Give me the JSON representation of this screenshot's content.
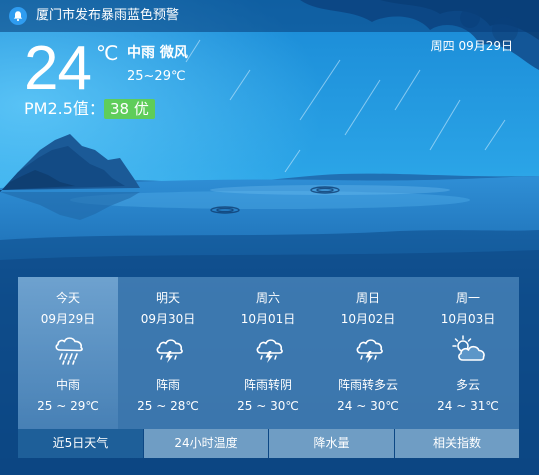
{
  "alert": {
    "text": "厦门市发布暴雨蓝色预警",
    "icon": "bell-icon"
  },
  "current": {
    "temperature": "24",
    "unit": "℃",
    "condition_wind": "中雨 微风",
    "temp_range": "25~29℃",
    "date": "周四 09月29日",
    "pm25_label": "PM2.5值：",
    "pm25_value": "38 优",
    "pm25_color": "#5fcd5a"
  },
  "forecast": [
    {
      "label": "今天",
      "date": "09月29日",
      "condition": "中雨",
      "temp": "25 ~ 29℃",
      "icon": "rain-cloud-icon"
    },
    {
      "label": "明天",
      "date": "09月30日",
      "condition": "阵雨",
      "temp": "25 ~ 28℃",
      "icon": "thunder-shower-icon"
    },
    {
      "label": "周六",
      "date": "10月01日",
      "condition": "阵雨转阴",
      "temp": "25 ~ 30℃",
      "icon": "thunder-shower-icon"
    },
    {
      "label": "周日",
      "date": "10月02日",
      "condition": "阵雨转多云",
      "temp": "24 ~ 30℃",
      "icon": "thunder-shower-icon"
    },
    {
      "label": "周一",
      "date": "10月03日",
      "condition": "多云",
      "temp": "24 ~ 31℃",
      "icon": "partly-cloudy-icon"
    }
  ],
  "tabs": [
    {
      "label": "近5日天气",
      "active": true
    },
    {
      "label": "24小时温度",
      "active": false
    },
    {
      "label": "降水量",
      "active": false
    },
    {
      "label": "相关指数",
      "active": false
    }
  ]
}
